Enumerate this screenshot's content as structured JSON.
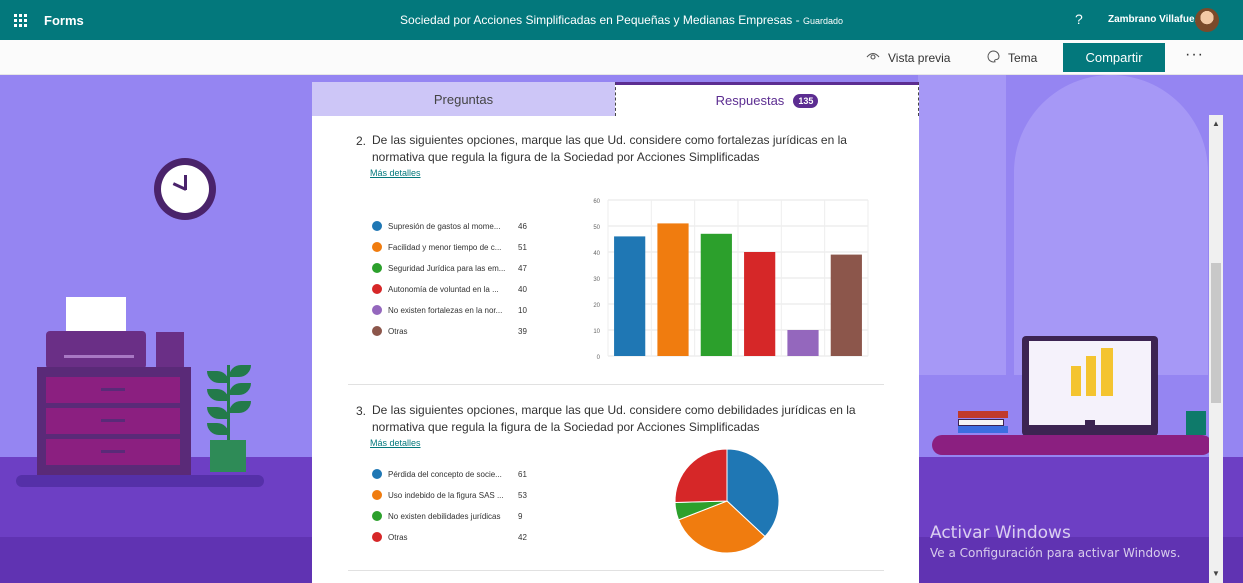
{
  "topbar": {
    "app_name": "Forms",
    "doc_title": "Sociedad por Acciones Simplificadas en Pequeñas y Medianas Empresas",
    "saved_status": "Guardado",
    "title_separator": " - ",
    "help": "?",
    "user_name": "Zambrano Villafue..."
  },
  "commandbar": {
    "preview_label": "Vista previa",
    "theme_label": "Tema",
    "share_label": "Compartir",
    "more_label": "···"
  },
  "tabs": {
    "questions_label": "Preguntas",
    "responses_label": "Respuestas",
    "responses_count": "135"
  },
  "questions": [
    {
      "number": "2.",
      "text": "De las siguientes opciones, marque las que Ud. considere como fortalezas jurídicas en la normativa que regula la figura de la Sociedad por Acciones Simplificadas",
      "more_details": "Más detalles",
      "options": [
        {
          "label": "Supresión de gastos al mome...",
          "count": "46",
          "color": "#1f77b4"
        },
        {
          "label": "Facilidad y menor tiempo de c...",
          "count": "51",
          "color": "#f07c0f"
        },
        {
          "label": "Seguridad Jurídica para las em...",
          "count": "47",
          "color": "#2ca02c"
        },
        {
          "label": "Autonomía de voluntad en la ...",
          "count": "40",
          "color": "#d62728"
        },
        {
          "label": "No existen fortalezas en la nor...",
          "count": "10",
          "color": "#9467bd"
        },
        {
          "label": "Otras",
          "count": "39",
          "color": "#8c564b"
        }
      ]
    },
    {
      "number": "3.",
      "text": "De las siguientes opciones, marque las que Ud. considere como debilidades jurídicas en la normativa que regula la figura de la Sociedad por Acciones Simplificadas",
      "more_details": "Más detalles",
      "options": [
        {
          "label": "Pérdida del concepto de socie...",
          "count": "61",
          "color": "#1f77b4"
        },
        {
          "label": "Uso indebido de la figura SAS ...",
          "count": "53",
          "color": "#f07c0f"
        },
        {
          "label": "No existen debilidades jurídicas",
          "count": "9",
          "color": "#2ca02c"
        },
        {
          "label": "Otras",
          "count": "42",
          "color": "#d62728"
        }
      ]
    }
  ],
  "chart_data": [
    {
      "type": "bar",
      "categories": [
        "Supresión de gastos al mome...",
        "Facilidad y menor tiempo de c...",
        "Seguridad Jurídica para las em...",
        "Autonomía de voluntad en la ...",
        "No existen fortalezas en la nor...",
        "Otras"
      ],
      "values": [
        46,
        51,
        47,
        40,
        10,
        39
      ],
      "colors": [
        "#1f77b4",
        "#f07c0f",
        "#2ca02c",
        "#d62728",
        "#9467bd",
        "#8c564b"
      ],
      "ylim": [
        0,
        60
      ],
      "yticks": [
        "0",
        "10",
        "20",
        "30",
        "40",
        "50",
        "60"
      ],
      "grid": true,
      "legend": "left"
    },
    {
      "type": "pie",
      "categories": [
        "Pérdida del concepto de socie...",
        "Uso indebido de la figura SAS ...",
        "No existen debilidades jurídicas",
        "Otras"
      ],
      "values": [
        61,
        53,
        9,
        42
      ],
      "colors": [
        "#1f77b4",
        "#f07c0f",
        "#2ca02c",
        "#d62728"
      ],
      "legend": "left"
    }
  ],
  "watermark": {
    "line1": "Activar Windows",
    "line2": "Ve a Configuración para activar Windows."
  },
  "scrollbar": {
    "up": "▲",
    "down": "▼"
  }
}
